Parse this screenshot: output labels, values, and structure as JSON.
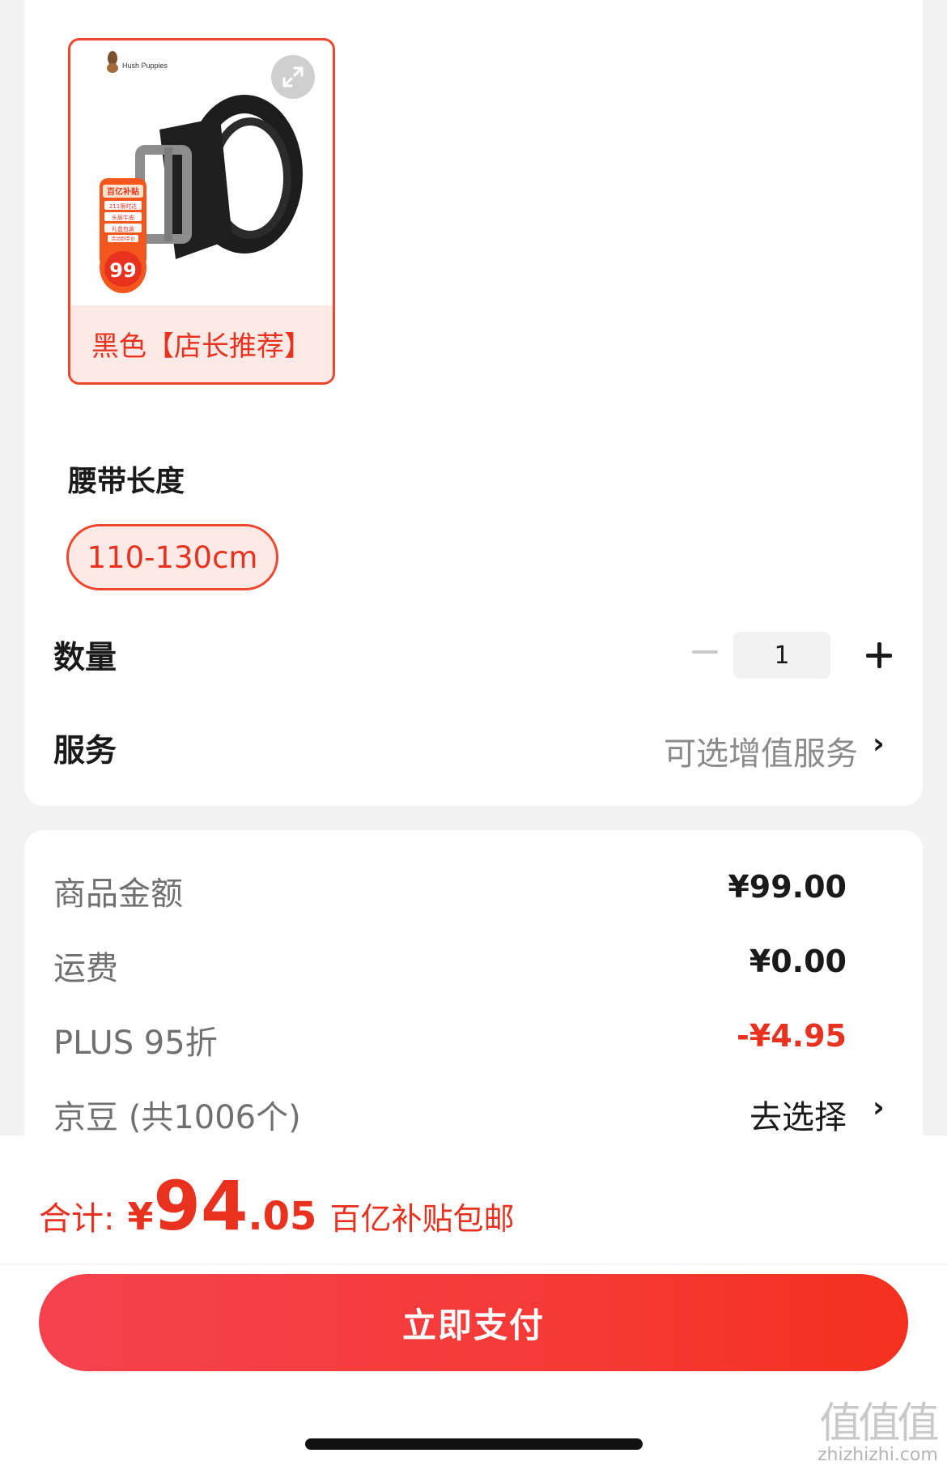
{
  "sku": {
    "brand_text": "Hush Puppies",
    "badge_title": "百亿补贴",
    "badge_lines": [
      "211限时达",
      "头层牛皮",
      "礼盒包装",
      "活动到手价"
    ],
    "badge_price": "99",
    "color_label": "黑色【店长推荐】"
  },
  "length": {
    "title": "腰带长度",
    "option": "110-130cm"
  },
  "quantity": {
    "label": "数量",
    "value": "1"
  },
  "service": {
    "label": "服务",
    "value": "可选增值服务",
    "chevron": "›"
  },
  "price": {
    "items": [
      {
        "label": "商品金额",
        "value": "¥99.00"
      },
      {
        "label": "运费",
        "value": "¥0.00"
      },
      {
        "label": "PLUS 95折",
        "value": "-¥4.95"
      },
      {
        "label": "京豆 (共1006个)",
        "value": "去选择"
      }
    ],
    "chevron": "›"
  },
  "total": {
    "label": "合计:",
    "yen": "¥",
    "integer": "94",
    "decimal": ".05",
    "note": "百亿补贴包邮"
  },
  "pay_button": "立即支付",
  "watermark": {
    "mark": "值值值",
    "site": "zhizhizhi.com"
  },
  "colors": {
    "accent": "#e8321f",
    "chip_bg": "#fdeae7",
    "page_bg": "#f2f2f2"
  }
}
